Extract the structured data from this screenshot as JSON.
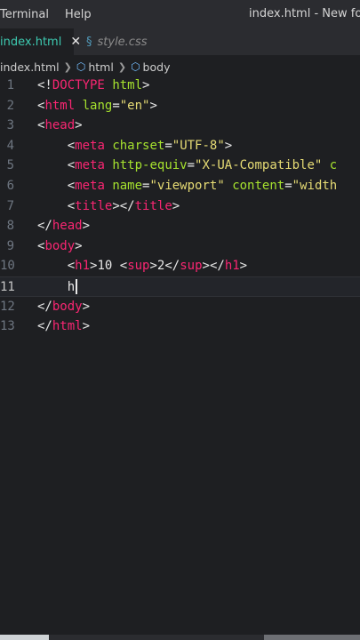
{
  "menubar": {
    "items": [
      "Terminal",
      "Help"
    ],
    "window_title": "index.html - New folder"
  },
  "tabs": [
    {
      "label": "index.html",
      "close": "✕"
    },
    {
      "label": "style.css",
      "icon": "css-file-icon"
    }
  ],
  "breadcrumb": {
    "file": "index.html",
    "items": [
      "html",
      "body"
    ],
    "icon": "symbol-cube-icon"
  },
  "editor": {
    "line_numbers": [
      "1",
      "2",
      "3",
      "4",
      "5",
      "6",
      "7",
      "8",
      "9",
      "10",
      "11",
      "12",
      "13"
    ],
    "current_line": "11",
    "lines": [
      {
        "indent": "",
        "tokens": [
          [
            "p",
            "<!"
          ],
          [
            "t",
            "DOCTYPE"
          ],
          [
            "p",
            " "
          ],
          [
            "a",
            "html"
          ],
          [
            "p",
            ">"
          ]
        ]
      },
      {
        "indent": "",
        "tokens": [
          [
            "p",
            "<"
          ],
          [
            "t",
            "html"
          ],
          [
            "p",
            " "
          ],
          [
            "a",
            "lang"
          ],
          [
            "p",
            "="
          ],
          [
            "s",
            "\"en\""
          ],
          [
            "p",
            ">"
          ]
        ]
      },
      {
        "indent": "",
        "tokens": [
          [
            "p",
            "<"
          ],
          [
            "t",
            "head"
          ],
          [
            "p",
            ">"
          ]
        ]
      },
      {
        "indent": "    ",
        "tokens": [
          [
            "p",
            "<"
          ],
          [
            "t",
            "meta"
          ],
          [
            "p",
            " "
          ],
          [
            "a",
            "charset"
          ],
          [
            "p",
            "="
          ],
          [
            "s",
            "\"UTF-8\""
          ],
          [
            "p",
            ">"
          ]
        ]
      },
      {
        "indent": "    ",
        "tokens": [
          [
            "p",
            "<"
          ],
          [
            "t",
            "meta"
          ],
          [
            "p",
            " "
          ],
          [
            "a",
            "http-equiv"
          ],
          [
            "p",
            "="
          ],
          [
            "s",
            "\"X-UA-Compatible\""
          ],
          [
            "p",
            " "
          ],
          [
            "a",
            "c"
          ]
        ]
      },
      {
        "indent": "    ",
        "tokens": [
          [
            "p",
            "<"
          ],
          [
            "t",
            "meta"
          ],
          [
            "p",
            " "
          ],
          [
            "a",
            "name"
          ],
          [
            "p",
            "="
          ],
          [
            "s",
            "\"viewport\""
          ],
          [
            "p",
            " "
          ],
          [
            "a",
            "content"
          ],
          [
            "p",
            "="
          ],
          [
            "s",
            "\"width"
          ]
        ]
      },
      {
        "indent": "    ",
        "tokens": [
          [
            "p",
            "<"
          ],
          [
            "t",
            "title"
          ],
          [
            "p",
            "></"
          ],
          [
            "t",
            "title"
          ],
          [
            "p",
            ">"
          ]
        ]
      },
      {
        "indent": "",
        "tokens": [
          [
            "p",
            "</"
          ],
          [
            "t",
            "head"
          ],
          [
            "p",
            ">"
          ]
        ]
      },
      {
        "indent": "",
        "tokens": [
          [
            "p",
            "<"
          ],
          [
            "t",
            "body"
          ],
          [
            "p",
            ">"
          ]
        ]
      },
      {
        "indent": "    ",
        "tokens": [
          [
            "p",
            "<"
          ],
          [
            "t",
            "h1"
          ],
          [
            "p",
            ">"
          ],
          [
            "tx",
            "10 "
          ],
          [
            "p",
            "<"
          ],
          [
            "t",
            "sup"
          ],
          [
            "p",
            ">"
          ],
          [
            "tx",
            "2"
          ],
          [
            "p",
            "</"
          ],
          [
            "t",
            "sup"
          ],
          [
            "p",
            "></"
          ],
          [
            "t",
            "h1"
          ],
          [
            "p",
            ">"
          ]
        ]
      },
      {
        "indent": "    ",
        "tokens": [
          [
            "tx",
            "h"
          ]
        ],
        "cursor": true
      },
      {
        "indent": "",
        "tokens": [
          [
            "p",
            "</"
          ],
          [
            "t",
            "body"
          ],
          [
            "p",
            ">"
          ]
        ]
      },
      {
        "indent": "",
        "tokens": [
          [
            "p",
            "</"
          ],
          [
            "t",
            "html"
          ],
          [
            "p",
            ">"
          ]
        ]
      }
    ]
  },
  "colors": {
    "tag": "#f92672",
    "attribute": "#a6e22e",
    "string": "#e6db74",
    "active_tab": "#3dc9b0"
  }
}
